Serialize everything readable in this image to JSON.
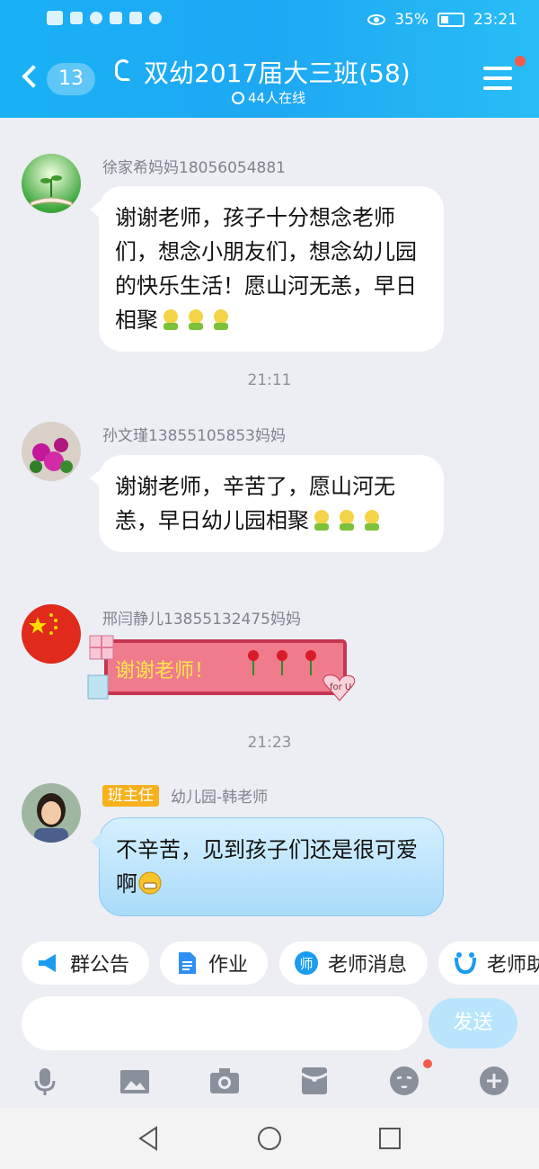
{
  "statusbar": {
    "battery": "35%",
    "time": "23:21"
  },
  "header": {
    "back_count": "13",
    "title": "双幼2017届大三班(58)",
    "online": "44人在线"
  },
  "messages": [
    {
      "sender": "徐家希妈妈18056054881",
      "text": "谢谢老师，孩子十分想念老师们，想念小朋友们，想念幼儿园的快乐生活！愿山河无恙，早日相聚"
    },
    {
      "time": "21:11",
      "sender": "孙文瑾13855105853妈妈",
      "text": "谢谢老师，辛苦了，愿山河无恙，早日幼儿园相聚"
    },
    {
      "sender": "邢闫静儿13855132475妈妈",
      "sticker_text": "谢谢老师！",
      "sticker_heart": "for U"
    },
    {
      "time": "21:23",
      "badge": "班主任",
      "sender": "幼儿园-韩老师",
      "text": "不辛苦，见到孩子们还是很可爱啊"
    }
  ],
  "quickbar": [
    {
      "label": "群公告",
      "icon": "megaphone-icon"
    },
    {
      "label": "作业",
      "icon": "document-icon"
    },
    {
      "label": "老师消息",
      "icon": "teacher-icon",
      "icon_char": "师"
    },
    {
      "label": "老师助手",
      "icon": "assistant-icon"
    }
  ],
  "input": {
    "placeholder": "",
    "send_label": "发送"
  },
  "toolbar": [
    "microphone-icon",
    "image-icon",
    "camera-icon",
    "red-packet-icon",
    "emoji-icon",
    "plus-icon"
  ],
  "colors": {
    "header": "#1ea8f3",
    "badge": "#f6b11d",
    "notification_dot": "#f35a4a",
    "send_button": "#b8e5fb"
  }
}
